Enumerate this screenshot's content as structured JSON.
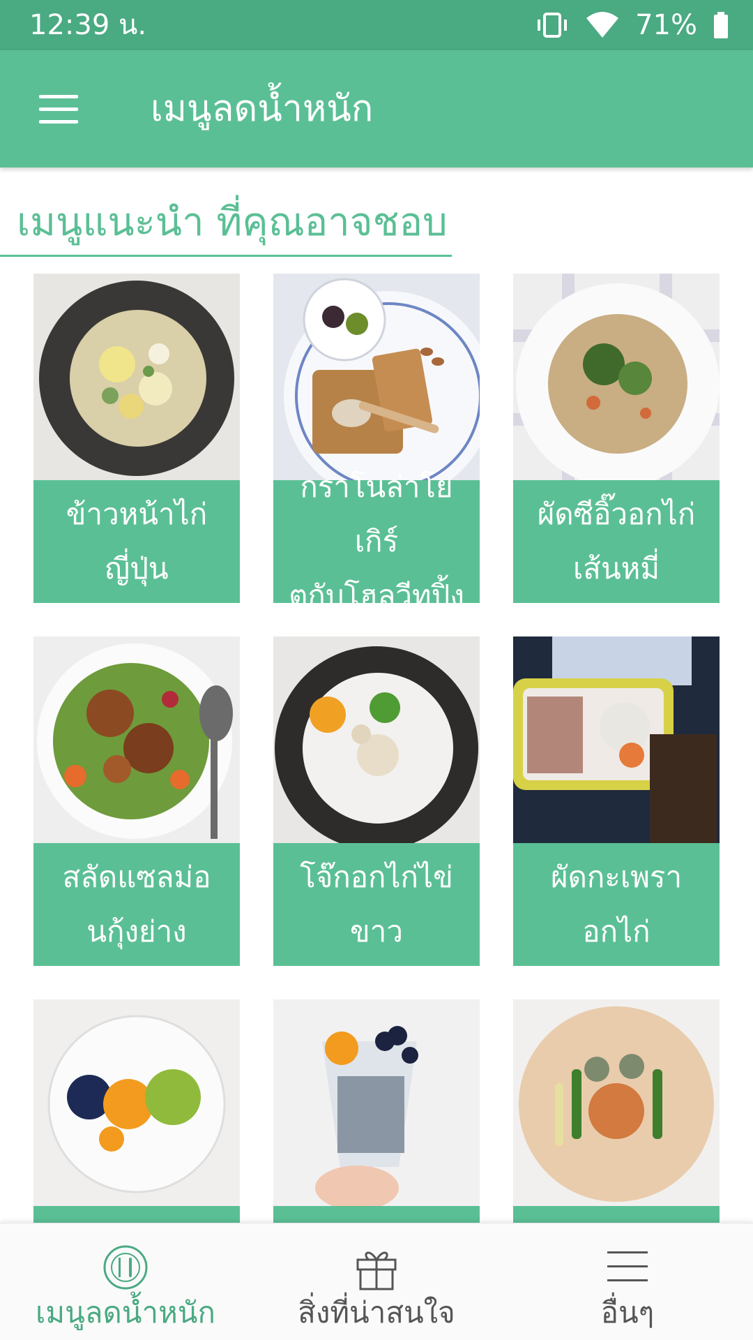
{
  "status_bar": {
    "time": "12:39 น.",
    "battery": "71%",
    "icons": [
      "vibrate-icon",
      "wifi-icon",
      "battery-icon"
    ]
  },
  "app_bar": {
    "menu_icon": "hamburger-menu-icon",
    "title": "เมนูลดน้ำหนัก"
  },
  "section": {
    "title": "เมนูแนะนำ ที่คุณอาจชอบ"
  },
  "menu_items": [
    {
      "line1": "ข้าวหน้าไก่",
      "line2": "ญี่ปุ่น"
    },
    {
      "line1": "กราโนล่าโยเกิร์",
      "line2": "ตกับโฮลวีทปิ้ง"
    },
    {
      "line1": "ผัดซีอิ๊วอกไก่",
      "line2": "เส้นหมี่"
    },
    {
      "line1": "สลัดแซลม่อ",
      "line2": "นกุ้งย่าง"
    },
    {
      "line1": "โจ๊กอกไก่ไข่ขาว",
      "line2": ""
    },
    {
      "line1": "ผัดกะเพรา",
      "line2": "อกไก่"
    },
    {
      "line1": "",
      "line2": ""
    },
    {
      "line1": "",
      "line2": ""
    },
    {
      "line1": "",
      "line2": ""
    }
  ],
  "bottom_nav": [
    {
      "label": "เมนูลดน้ำหนัก",
      "icon": "plate-cutlery-icon",
      "active": true
    },
    {
      "label": "สิ่งที่น่าสนใจ",
      "icon": "gift-icon",
      "active": false
    },
    {
      "label": "อื่นๆ",
      "icon": "menu-lines-icon",
      "active": false
    }
  ],
  "colors": {
    "status_bar": "#4aaa82",
    "primary": "#5bbf95",
    "nav_inactive": "#555555"
  }
}
